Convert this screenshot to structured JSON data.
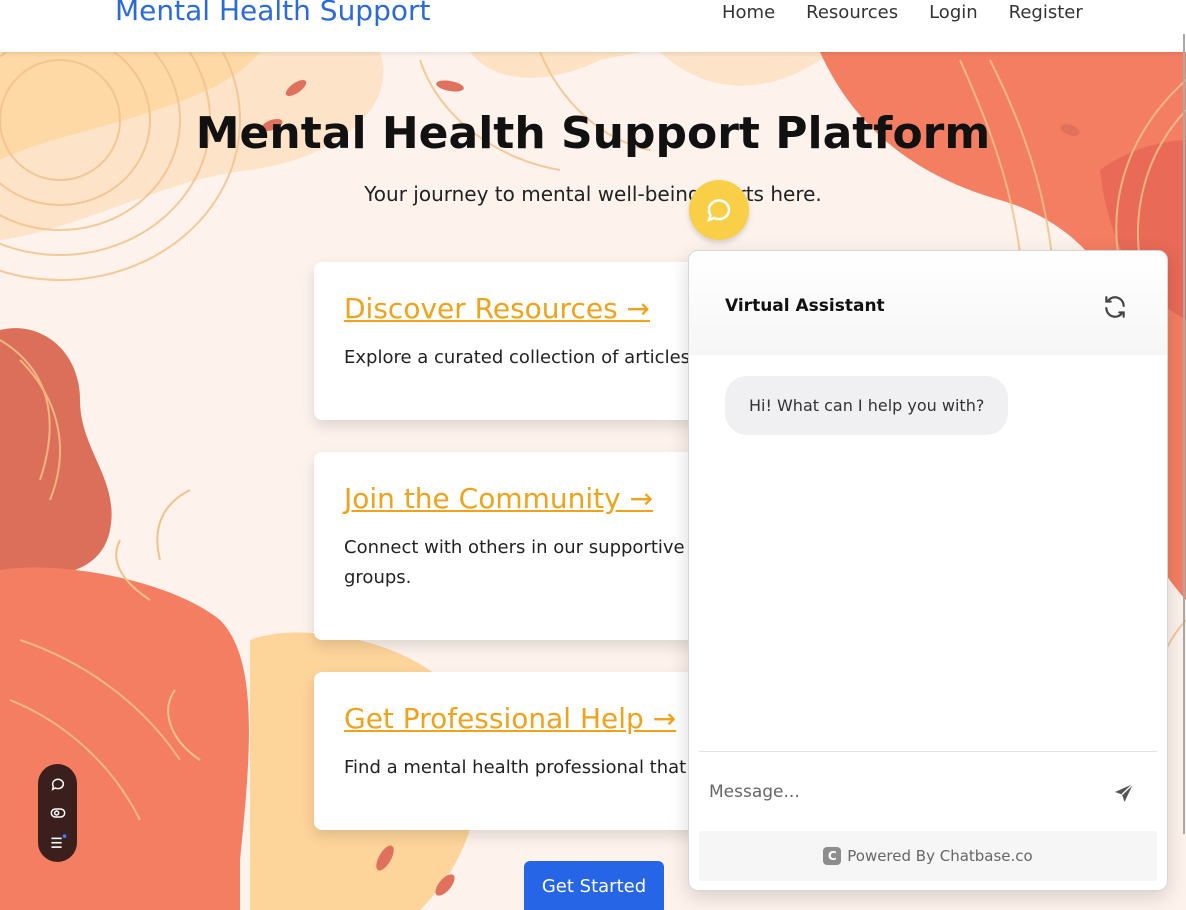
{
  "navbar": {
    "brand": "Mental Health Support",
    "links": [
      "Home",
      "Resources",
      "Login",
      "Register"
    ]
  },
  "hero": {
    "title": "Mental Health Support Platform",
    "subtitle": "Your journey to mental well-being starts here."
  },
  "cards": [
    {
      "title": "Discover Resources →",
      "text": "Explore a curated collection of articles,"
    },
    {
      "title": "Join the Community →",
      "text": "Connect with others in our supportive f groups."
    },
    {
      "title": "Get Professional Help →",
      "text": "Find a mental health professional that s"
    }
  ],
  "cta": {
    "label": "Get Started"
  },
  "chat": {
    "title": "Virtual Assistant",
    "greeting": "Hi! What can I help you with?",
    "input_placeholder": "Message...",
    "footer": "Powered By Chatbase.co",
    "footer_logo": "C"
  },
  "icons": {
    "launcher": "chat-bubble-icon",
    "refresh": "refresh-icon",
    "send": "send-icon",
    "toolbar": [
      "chat-bubble-icon",
      "toggle-icon",
      "menu-icon"
    ]
  },
  "colors": {
    "brand": "#2a6bd8",
    "card_title": "#f0a21a",
    "cta": "#2565e6",
    "launcher": "#f9cf48",
    "toolbar": "#3a1f1c",
    "coral": "#f47e62",
    "peach": "#fdd49a"
  }
}
